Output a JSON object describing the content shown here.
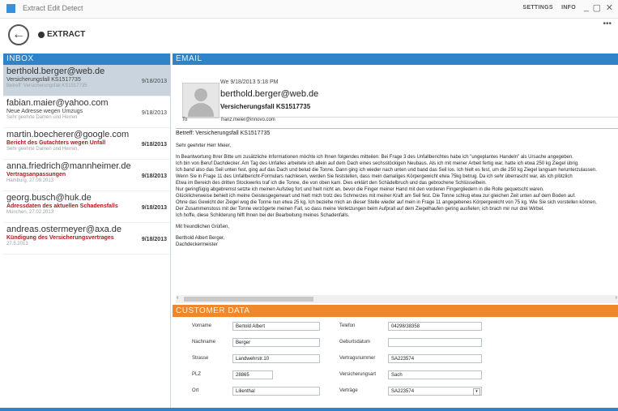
{
  "app": {
    "title": "Extract Edit Detect",
    "top_links": [
      "SETTINGS",
      "INFO"
    ],
    "window_controls": [
      "_",
      "▢",
      "✕"
    ],
    "toolbar_action": "EXTRACT"
  },
  "inbox": {
    "header": "INBOX",
    "items": [
      {
        "from": "berthold.berger@web.de",
        "subject": "Versicherungsfall KS1517735",
        "date": "9/18/2013",
        "preview": "Betreff: Versicherungsfall KS1517735",
        "unread": false,
        "selected": true
      },
      {
        "from": "fabian.maier@yahoo.com",
        "subject": "Neue Adresse wegen Umzugs",
        "date": "9/18/2013",
        "preview": "Sehr geehrte Damen und Herren",
        "unread": false,
        "selected": false
      },
      {
        "from": "martin.boecherer@google.com",
        "subject": "Bericht des Gutachters wegen Unfall",
        "date": "9/18/2013",
        "preview": "Sehr geehrte Damen und Herren,",
        "unread": true,
        "selected": false
      },
      {
        "from": "anna.friedrich@mannheimer.de",
        "subject": "Vertragsanpassungen",
        "date": "9/18/2013",
        "preview": "Hamburg, 27.09.2013",
        "unread": true,
        "selected": false
      },
      {
        "from": "georg.busch@huk.de",
        "subject": "Adressdaten des aktuellen Schadensfalls",
        "date": "9/18/2013",
        "preview": "München, 27.02.2013",
        "unread": true,
        "selected": false
      },
      {
        "from": "andreas.ostermeyer@axa.de",
        "subject": "Kündigung des Versicherungsvertrages",
        "date": "9/18/2013",
        "preview": "27.5.2013",
        "unread": true,
        "selected": false
      }
    ]
  },
  "email": {
    "header": "EMAIL",
    "datetime": "We 9/18/2013 5:18 PM",
    "from": "berthold.berger@web.de",
    "subject": "Versicherungsfall KS1517735",
    "to_label": "To",
    "to": "franz.meier@innovo.com",
    "subject_line": "Betreff: Versicherungsfall KS1517735",
    "body": [
      "Sehr geehrter Herr Meier,",
      "In Beantwortung Ihrer Bitte um zusätzliche Informationen möchte ich Ihnen folgendes mitteilen: Bei Frage 3 des Unfallberichtes habe ich \"ungeplantes Handeln\" als Ursache angegeben.\nIch bin von Beruf Dachdecker. Am Tag des Unfalles arbeitete ich allein auf dem Dach eines sechsstöckigen Neubaus. Als ich mit meiner Arbeit fertig war, hatte ich etwa 250 kg Ziegel übrig.\nIch band also das Seil unten fest, ging auf das Dach und belud die Tonne. Dann ging ich wieder nach unten und band das Seil los. Ich hielt es fest, um die 250 kg Ziegel langsam herunterzulassen.\nWenn Sie in Frage 11 des Unfallbericht-Formulars nachlesen, werden Sie feststellen, dass mein damaliges Körpergewicht etwa 75kg betrug. Da ich sehr überrascht war, als ich plötzlich\nEtwa im Bereich des dritten Stockwerks traf ich die Tonne, die von oben kam. Dies erklärt den Schädelbruch und das gebrochene Schlüsselbein.\nNur geringfügig abgebremst setzte ich meinen Aufstieg fort und hielt nicht an, bevor die Finger meiner Hand mit den vorderen Fingergliedern in die Rolle gequetscht waren.\nGlücklicherweise behielt ich meine Geistesgegenwart und hielt mich trotz des Schmerzes mit meiner Kraft am Seil fest. Die Tonne schlug etwa zur gleichen Zeit unten auf dem Boden auf.\nOhne das Gewicht der Ziegel wog die Tonne nun etwa 25 kg. Ich beziehe mich an dieser Stelle wieder auf mein in Frage 11 angegebenes Körpergewicht von 75 kg. Wie Sie sich vorstellen können,\nDer Zusammenstoss mit der Tonne verzögerte meinen Fall, so dass meine Verletzungen beim Aufprall auf dem Ziegelhaufen gering ausfielen; ich brach mir nur drei Wirbel.\nIch hoffe, diese Schilderung hilft Ihnen bei der Bearbeitung meines Schadenfalls.",
      "Mit freundlichen Grüßen,",
      "Berthold Albert Berger,\nDachdeckermeister"
    ]
  },
  "customer": {
    "header": "CUSTOMER DATA",
    "fields": {
      "vorname": {
        "label": "Vorname",
        "value": "Bertold Albert"
      },
      "nachname": {
        "label": "Nachname",
        "value": "Berger"
      },
      "strasse": {
        "label": "Strasse",
        "value": "Landwehrstr.10"
      },
      "plz": {
        "label": "PLZ",
        "value": "28865"
      },
      "ort": {
        "label": "Ort",
        "value": "Lilienthal"
      },
      "telefon": {
        "label": "Telefon",
        "value": "04298/38358"
      },
      "geburtsdatum": {
        "label": "Geburtsdatum",
        "value": ""
      },
      "vertragsnummer": {
        "label": "Vertragsnummer",
        "value": "SA223574"
      },
      "versicherungsart": {
        "label": "Versicherungsart",
        "value": "Sach"
      },
      "vertraege": {
        "label": "Verträge",
        "value": "SA223574"
      }
    }
  },
  "colors": {
    "inbox_header": "#2f83c6",
    "customer_header": "#f0872a",
    "unread_subject": "#b0191e",
    "selected_row": "#c9d4de"
  },
  "icons": [
    "app-icon",
    "back-arrow-icon",
    "extract-icon",
    "avatar-icon",
    "dropdown-arrow-icon"
  ]
}
